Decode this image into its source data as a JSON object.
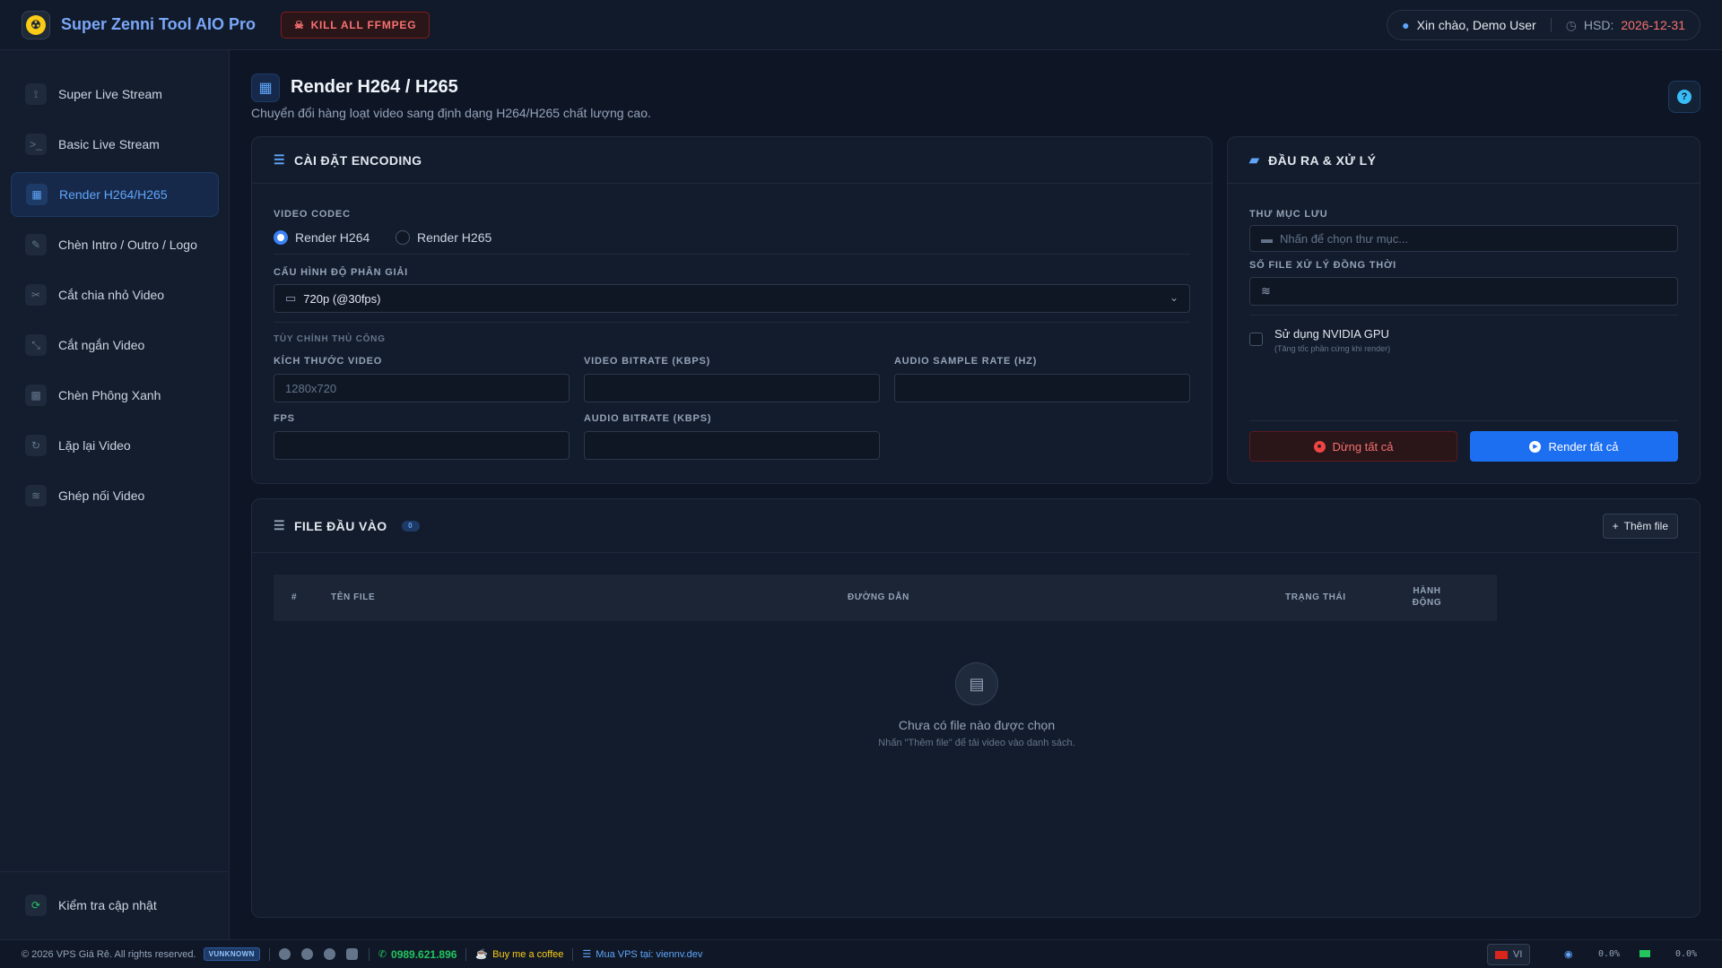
{
  "app": {
    "title": "Super Zenni Tool AIO Pro",
    "kill_label": "KILL ALL FFMPEG"
  },
  "user": {
    "greeting": "Xin chào, Demo User",
    "expiry_label": "HSD:",
    "expiry_date": "2026-12-31"
  },
  "sidebar": {
    "items": [
      {
        "label": "Super Live Stream",
        "icon": "antenna-icon"
      },
      {
        "label": "Basic Live Stream",
        "icon": "terminal-icon"
      },
      {
        "label": "Render H264/H265",
        "icon": "film-icon",
        "active": true
      },
      {
        "label": "Chèn Intro / Outro / Logo",
        "icon": "brush-icon"
      },
      {
        "label": "Cắt chia nhỏ Video",
        "icon": "scissors-icon"
      },
      {
        "label": "Cắt ngắn Video",
        "icon": "compress-icon"
      },
      {
        "label": "Chèn Phông Xanh",
        "icon": "greenscreen-icon"
      },
      {
        "label": "Lặp lại Video",
        "icon": "repeat-icon"
      },
      {
        "label": "Ghép nối Video",
        "icon": "layers-icon"
      }
    ],
    "update_label": "Kiểm tra cập nhật"
  },
  "page": {
    "title": "Render H264 / H265",
    "subtitle": "Chuyển đổi hàng loạt video sang định dạng H264/H265 chất lượng cao."
  },
  "encoding": {
    "title": "CÀI ĐẶT ENCODING",
    "codec_label": "VIDEO CODEC",
    "codec_h264": "Render H264",
    "codec_h265": "Render H265",
    "selected_codec": "H264",
    "resolution_label": "CẤU HÌNH ĐỘ PHÂN GIẢI",
    "resolution_value": "720p (@30fps)",
    "custom_label": "TÙY CHỈNH THỦ CÔNG",
    "size_label": "KÍCH THƯỚC VIDEO",
    "size_placeholder": "1280x720",
    "vbitrate_label": "VIDEO BITRATE (KBPS)",
    "samplerate_label": "AUDIO SAMPLE RATE (HZ)",
    "fps_label": "FPS",
    "abitrate_label": "AUDIO BITRATE (KBPS)"
  },
  "output": {
    "title": "ĐẦU RA & XỬ LÝ",
    "folder_label": "THƯ MỤC LƯU",
    "folder_placeholder": "Nhấn để chọn thư mục...",
    "concurrent_label": "SỐ FILE XỬ LÝ ĐỒNG THỜI",
    "gpu_label": "Sử dụng NVIDIA GPU",
    "gpu_hint": "(Tăng tốc phần cứng khi render)",
    "stop_label": "Dừng tất cả",
    "render_label": "Render tất cả"
  },
  "files": {
    "title": "FILE ĐẦU VÀO",
    "count": "0",
    "add_label": "Thêm file",
    "columns": [
      "#",
      "TÊN FILE",
      "ĐƯỜNG DẪN",
      "TRẠNG THÁI",
      "HÀNH ĐỘNG"
    ],
    "empty_title": "Chưa có file nào được chọn",
    "empty_hint": "Nhấn \"Thêm file\" để tải video vào danh sách."
  },
  "footer": {
    "copyright": "© 2026 VPS Giá Rẻ. All rights reserved.",
    "badge": "VUNKNOWN",
    "phone": "0989.621.896",
    "coffee": "Buy me a coffee",
    "vps": "Mua VPS tại: viennv.dev",
    "lang": "VI",
    "cpu": "0.0%",
    "ram": "0.0%"
  },
  "colors": {
    "accent": "#3b82f6",
    "danger": "#f87171",
    "success": "#22c55e"
  }
}
